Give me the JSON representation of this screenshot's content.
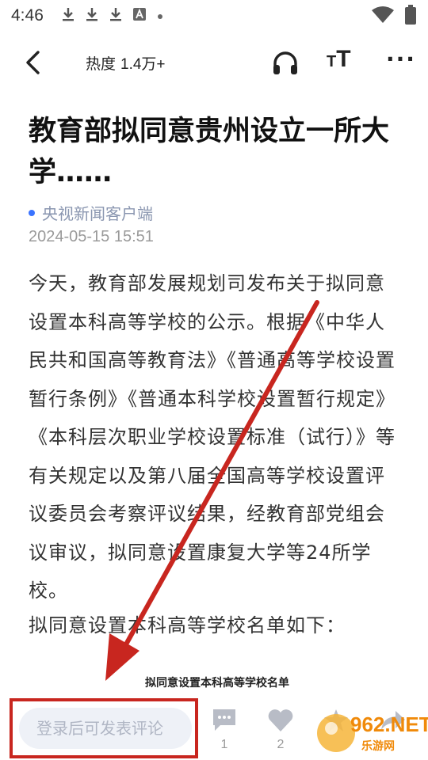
{
  "status_bar": {
    "time": "4:46"
  },
  "top_bar": {
    "heat_label": "热度",
    "heat_value": "1.4万+",
    "font_small": "T",
    "font_big": "T",
    "more_label": "···"
  },
  "article": {
    "title": "教育部拟同意贵州设立一所大学……",
    "source": "央视新闻客户端",
    "datetime": "2024-05-15 15:51",
    "body": "今天，教育部发展规划司发布关于拟同意设置本科高等学校的公示。根据《中华人民共和国高等教育法》《普通高等学校设置暂行条例》《普通本科学校设置暂行规定》《本科层次职业学校设置标准（试行）》等有关规定以及第八届全国高等学校设置评议委员会考察评议结果，经教育部党组会议审议，拟同意设置康复大学等24所学校。",
    "subhead": "拟同意设置本科高等学校名单如下：",
    "table_caption": "拟同意设置本科高等学校名单"
  },
  "bottom_bar": {
    "comment_placeholder": "登录后可发表评论",
    "comment_count": "1",
    "like_count": "2"
  },
  "watermark": {
    "top": "962.NET",
    "bottom": "乐游网"
  },
  "colors": {
    "accent": "#3a73ff",
    "annotation_red": "#c8261f",
    "watermark_orange": "#f08a0a"
  },
  "icons": [
    "download-icon",
    "download-icon",
    "download-icon",
    "a-icon",
    "dot-icon",
    "wifi-icon",
    "battery-icon",
    "back-arrow-icon",
    "headphones-icon",
    "font-size-icon",
    "more-icon",
    "comment-icon",
    "heart-icon",
    "star-icon",
    "share-icon"
  ]
}
